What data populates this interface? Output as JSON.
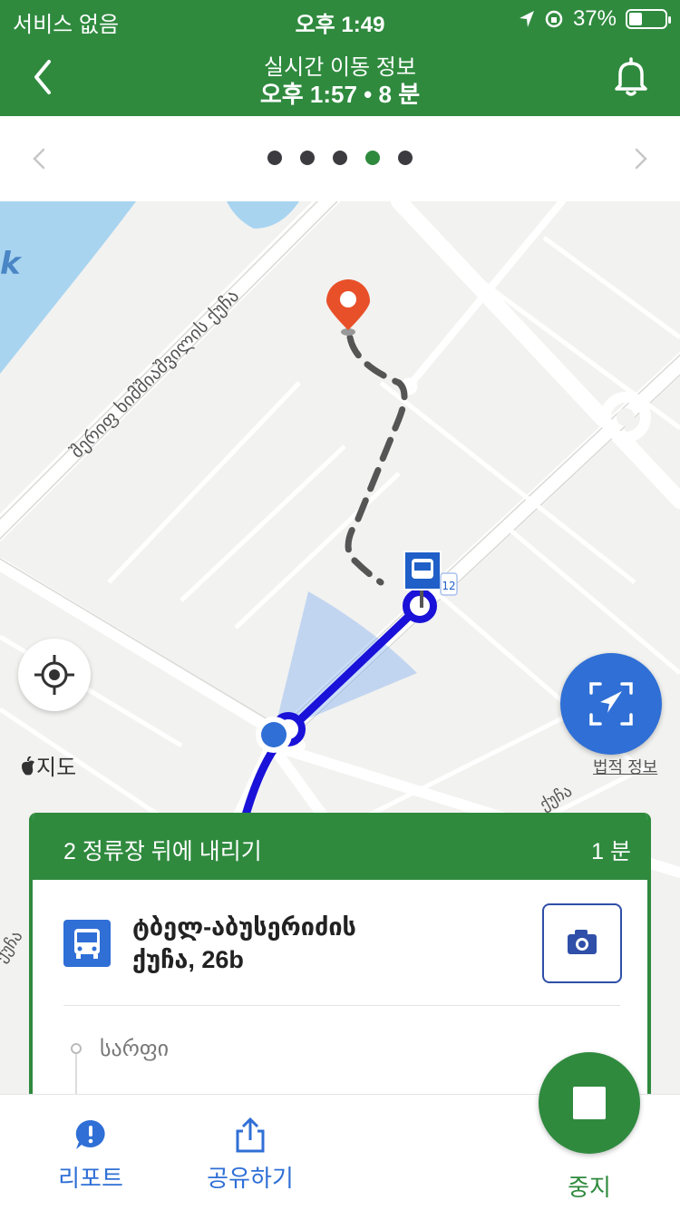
{
  "status_bar": {
    "carrier": "서비스 없음",
    "time": "오후 1:49",
    "battery_text": "37%",
    "battery_level": 0.37
  },
  "header": {
    "title": "실시간 이동 정보",
    "subtitle": "오후 1:57 • 8 분"
  },
  "pager": {
    "pages": 5,
    "active_index": 3
  },
  "map": {
    "street_label": "შერიფ ხიმშიაშვილის ქუჩა",
    "bus_stop_badge": "12",
    "lake_letter": "k",
    "maps_brand": "지도",
    "legal_text": "법적 정보",
    "edge_labels": [
      "ქუჩა",
      "ქუჩა"
    ]
  },
  "card": {
    "header_left": "2 정류장 뒤에 내리기",
    "header_right": "1 분",
    "stop_name_line1": "ტბელ-აბუსერიძის",
    "stop_name_line2": "ქუჩა, 26b",
    "next_stop": "სარფი"
  },
  "bottom_bar": {
    "report_label": "리포트",
    "share_label": "공유하기",
    "stop_label": "중지"
  },
  "colors": {
    "primary_green": "#2f8a3e",
    "route_blue": "#1a12d8",
    "accent_blue": "#2f6fd6",
    "pin_orange": "#e8502a"
  }
}
